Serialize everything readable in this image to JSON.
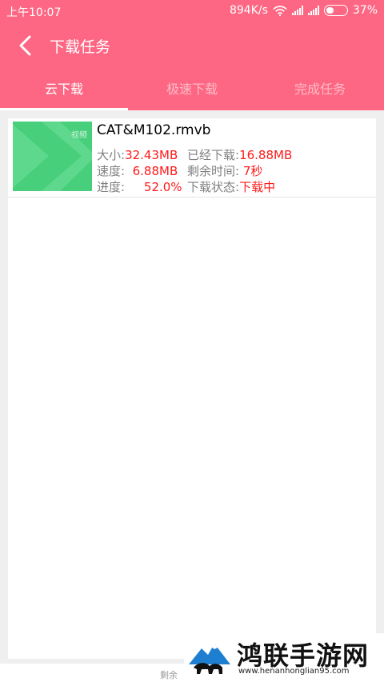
{
  "status_bar": {
    "time": "上午10:07",
    "speed": "894K/s",
    "battery": "37%",
    "icons": [
      "wifi-icon",
      "signal-icon",
      "signal-icon",
      "battery-icon"
    ]
  },
  "app_bar": {
    "title": "下载任务",
    "back_icon": "chevron-left-icon"
  },
  "tabs": [
    {
      "label": "云下载",
      "active": true
    },
    {
      "label": "极速下载",
      "active": false
    },
    {
      "label": "完成任务",
      "active": false
    }
  ],
  "task": {
    "file_name": "CAT&M102.rmvb",
    "thumbnail_label": "视频",
    "size_label": "大小:",
    "size_value": "32.43MB",
    "downloaded_label": "已经下载:",
    "downloaded_value": "16.88MB",
    "speed_label": "速度:",
    "speed_value": "6.88MB",
    "remaining_label": "剩余时间:",
    "remaining_value": "7秒",
    "progress_label": "进度:",
    "progress_value": "52.0%",
    "status_label": "下载状态:",
    "status_value": "下载中"
  },
  "bottom_bar": {
    "label": "剩余"
  },
  "watermark": {
    "title": "鸿联手游网",
    "url": "www.henanhonglian95.com"
  },
  "colors": {
    "accent": "#fd6783",
    "value_red": "#ff1a1a",
    "thumbnail_green": "#47cf7b"
  }
}
